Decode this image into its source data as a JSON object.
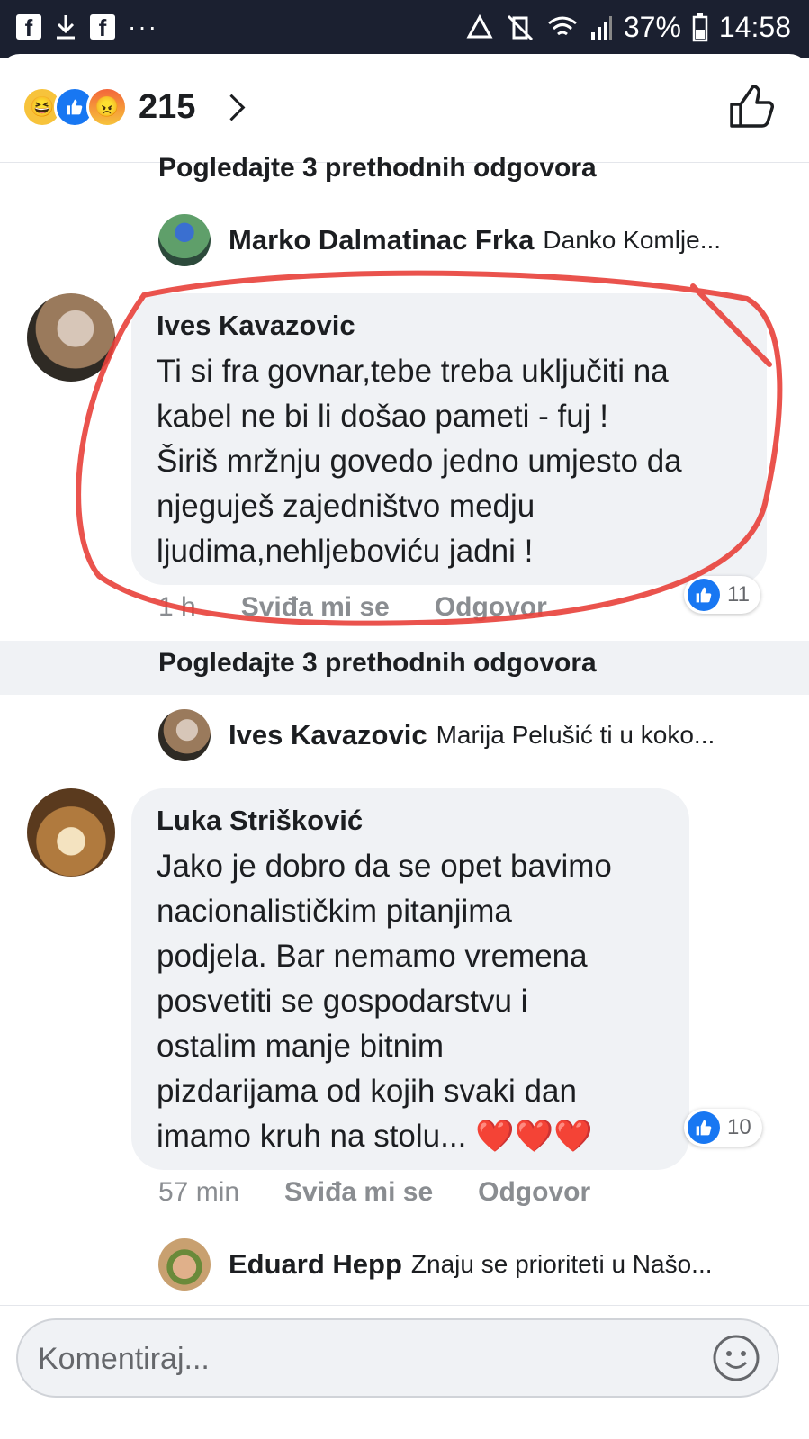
{
  "status_bar": {
    "battery": "37%",
    "time": "14:58",
    "left_icons": [
      "facebook-icon",
      "download-icon",
      "facebook-icon",
      "more-dots-icon"
    ],
    "right_icons": [
      "recycle-icon",
      "vibrate-mute-icon",
      "wifi-icon",
      "signal-icon",
      "battery-icon"
    ]
  },
  "header": {
    "reactions": [
      "haha",
      "like",
      "angry"
    ],
    "reaction_count": "215"
  },
  "thread": {
    "see_previous_1": "Pogledajte 3 prethodnih odgovora",
    "reply_1": {
      "name": "Marko Dalmatinac Frka",
      "text": "Danko Komlje..."
    },
    "comment_1": {
      "name": "Ives Kavazovic",
      "text": "Ti si fra govnar,tebe treba uključiti na\nkabel ne bi li došao pameti  - fuj !\nŠiriš mržnju govedo jedno umjesto da\nnjeguješ zajedništvo medju\nljudima,nehljebovi​ću jadni !",
      "time": "1 h",
      "like_label": "Sviđa mi se",
      "reply_label": "Odgovor",
      "likes": "11"
    },
    "see_previous_2": "Pogledajte 3 prethodnih odgovora",
    "reply_2": {
      "name": "Ives Kavazovic",
      "text": "Marija Pelušić ti u koko..."
    },
    "comment_2": {
      "name": "Luka Strišković",
      "text": "Jako je dobro da se opet bavimo\nnacionalističkim pitanjima\npodjela. Bar nemamo vremena\nposvetiti se gospodarstvu i\nostalim manje bitnim\npizdarijama od kojih svaki dan\nimamo kruh na stolu... ❤️❤️❤️",
      "time": "57 min",
      "like_label": "Sviđa mi se",
      "reply_label": "Odgovor",
      "likes": "10"
    },
    "reply_3": {
      "name": "Eduard Hepp",
      "text": "Znaju se prioriteti u Našo..."
    }
  },
  "composer": {
    "placeholder": "Komentiraj..."
  },
  "colors": {
    "accent": "#1877f2",
    "annotation_red": "#e8403a",
    "bubble_bg": "#f0f2f5",
    "status_bar_bg": "#1b2030"
  }
}
